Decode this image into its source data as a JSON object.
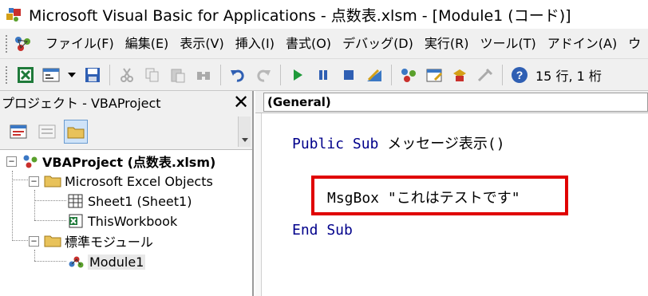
{
  "window": {
    "title": "Microsoft Visual Basic for Applications - 点数表.xlsm - [Module1 (コード)]"
  },
  "menu": {
    "items": [
      "ファイル(F)",
      "編集(E)",
      "表示(V)",
      "挿入(I)",
      "書式(O)",
      "デバッグ(D)",
      "実行(R)",
      "ツール(T)",
      "アドイン(A)",
      "ウ"
    ]
  },
  "toolbar": {
    "buttons": [
      "view-excel",
      "insert-module",
      "dropdown",
      "save",
      "cut",
      "copy",
      "paste",
      "find",
      "undo",
      "redo",
      "run",
      "break",
      "reset",
      "design-mode",
      "project-explorer",
      "properties",
      "object-browser",
      "toolbox",
      "help"
    ],
    "position_text": "15 行, 1 桁"
  },
  "project_panel": {
    "title": "プロジェクト - VBAProject",
    "tree": {
      "root": "VBAProject (点数表.xlsm)",
      "folder1": "Microsoft Excel Objects",
      "sheet1": "Sheet1 (Sheet1)",
      "workbook": "ThisWorkbook",
      "folder2": "標準モジュール",
      "module1": "Module1"
    }
  },
  "code_window": {
    "object_combo": "(General)",
    "lines": {
      "line1_kw": "Public Sub",
      "line1_name": " メッセージ表示()",
      "line2": "MsgBox \"これはテストです\"",
      "line3_kw": "End Sub"
    }
  },
  "colors": {
    "keyword": "#00008b",
    "highlight_border": "#e00000",
    "chrome": "#f0f0f0"
  }
}
